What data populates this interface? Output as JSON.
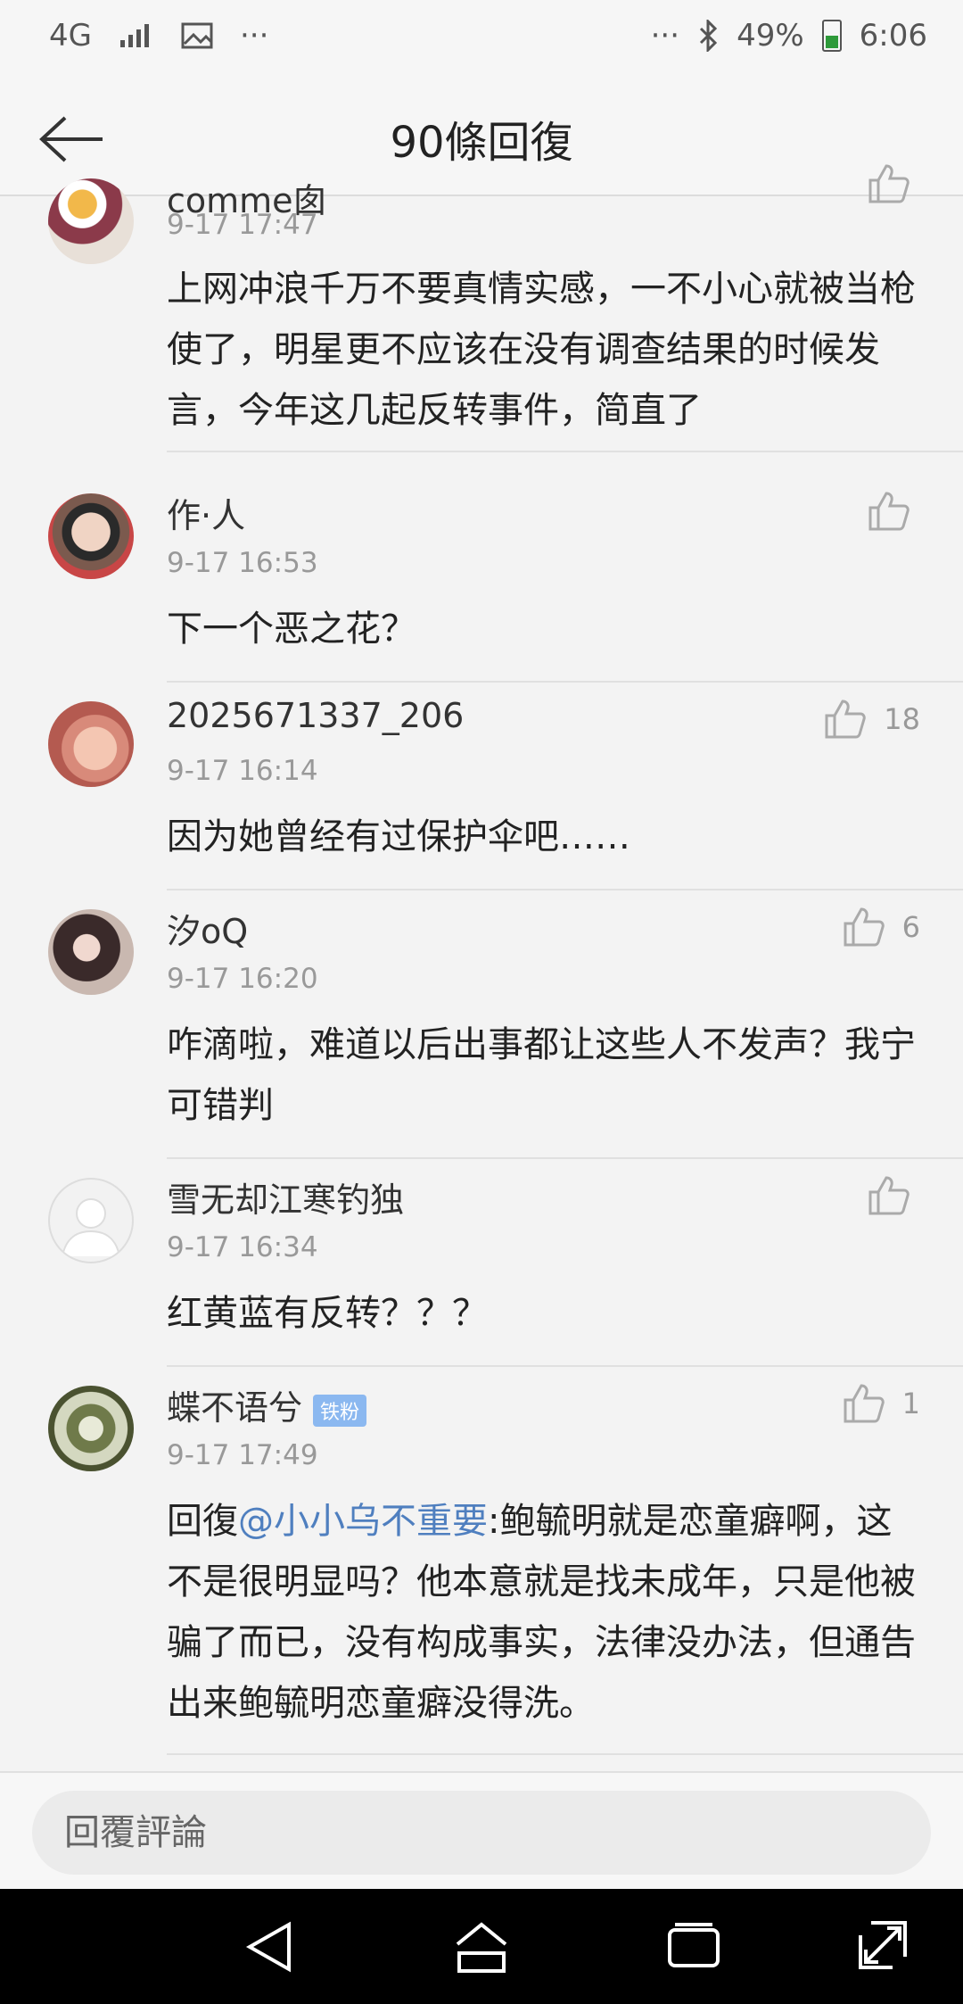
{
  "status_bar": {
    "network": "4G",
    "battery_percent": "49%",
    "time": "6:06",
    "more_dots": "···"
  },
  "header": {
    "title": "90條回復"
  },
  "comments": [
    {
      "username": "comme囱",
      "time": "9-17 17:47",
      "text": "上网冲浪千万不要真情实感，一不小心就被当枪使了，明星更不应该在没有调查结果的时候发言，今年这几起反转事件，简直了",
      "likes": ""
    },
    {
      "username": "作·人",
      "time": "9-17 16:53",
      "text": "下一个恶之花？",
      "likes": ""
    },
    {
      "username": "2025671337_206",
      "time": "9-17 16:14",
      "text": "因为她曾经有过保护伞吧……",
      "likes": "18"
    },
    {
      "username": "汐oQ",
      "time": "9-17 16:20",
      "text": "咋滴啦，难道以后出事都让这些人不发声？我宁可错判",
      "likes": "6"
    },
    {
      "username": "雪无却江寒钓独",
      "time": "9-17 16:34",
      "text": "红黄蓝有反转？？？",
      "likes": ""
    },
    {
      "username": "蝶不语兮",
      "badge": "铁粉",
      "time": "9-17 17:49",
      "reply_prefix": "回復",
      "mention": "@小小乌不重要",
      "text": ":鲍毓明就是恋童癖啊，这不是很明显吗？他本意就是找未成年，只是他被骗了而已，没有构成事实，法律没办法，但通告出来鲍毓明恋童癖没得洗。",
      "likes": "1"
    }
  ],
  "input": {
    "placeholder": "回覆評論"
  },
  "icons": {
    "back": "back-arrow-icon",
    "like": "thumbs-up-icon",
    "nav_back": "nav-back-icon",
    "nav_home": "nav-home-icon",
    "nav_recent": "nav-recents-icon",
    "nav_expand": "nav-expand-icon"
  }
}
